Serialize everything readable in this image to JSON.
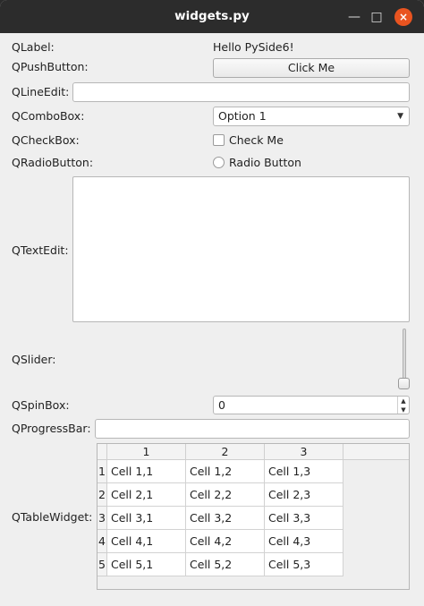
{
  "window": {
    "title": "widgets.py",
    "minimize_glyph": "—",
    "maximize_glyph": "□",
    "close_glyph": "×"
  },
  "labels": {
    "qlabel": "QLabel:",
    "qpushbutton": "QPushButton:",
    "qlineedit": "QLineEdit:",
    "qcombobox": "QComboBox:",
    "qcheckbox": "QCheckBox:",
    "qradiobutton": "QRadioButton:",
    "qtextedit": "QTextEdit:",
    "qslider": "QSlider:",
    "qspinbox": "QSpinBox:",
    "qprogressbar": "QProgressBar:",
    "qtablewidget": "QTableWidget:"
  },
  "widgets": {
    "label_text": "Hello PySide6!",
    "button_label": "Click Me",
    "line_edit_value": "",
    "combo_selected": "Option 1",
    "checkbox_label": "Check Me",
    "checkbox_checked": false,
    "radio_label": "Radio Button",
    "radio_checked": false,
    "text_edit_value": "",
    "slider_value": 0,
    "spinbox_value": "0",
    "progress_value": 0
  },
  "table": {
    "columns": [
      "1",
      "2",
      "3"
    ],
    "row_headers": [
      "1",
      "2",
      "3",
      "4",
      "5"
    ],
    "rows": [
      [
        "Cell 1,1",
        "Cell 1,2",
        "Cell 1,3"
      ],
      [
        "Cell 2,1",
        "Cell 2,2",
        "Cell 2,3"
      ],
      [
        "Cell 3,1",
        "Cell 3,2",
        "Cell 3,3"
      ],
      [
        "Cell 4,1",
        "Cell 4,2",
        "Cell 4,3"
      ],
      [
        "Cell 5,1",
        "Cell 5,2",
        "Cell 5,3"
      ]
    ]
  },
  "colors": {
    "titlebar": "#2c2c2c",
    "close_button": "#e95420",
    "background": "#efefef"
  }
}
